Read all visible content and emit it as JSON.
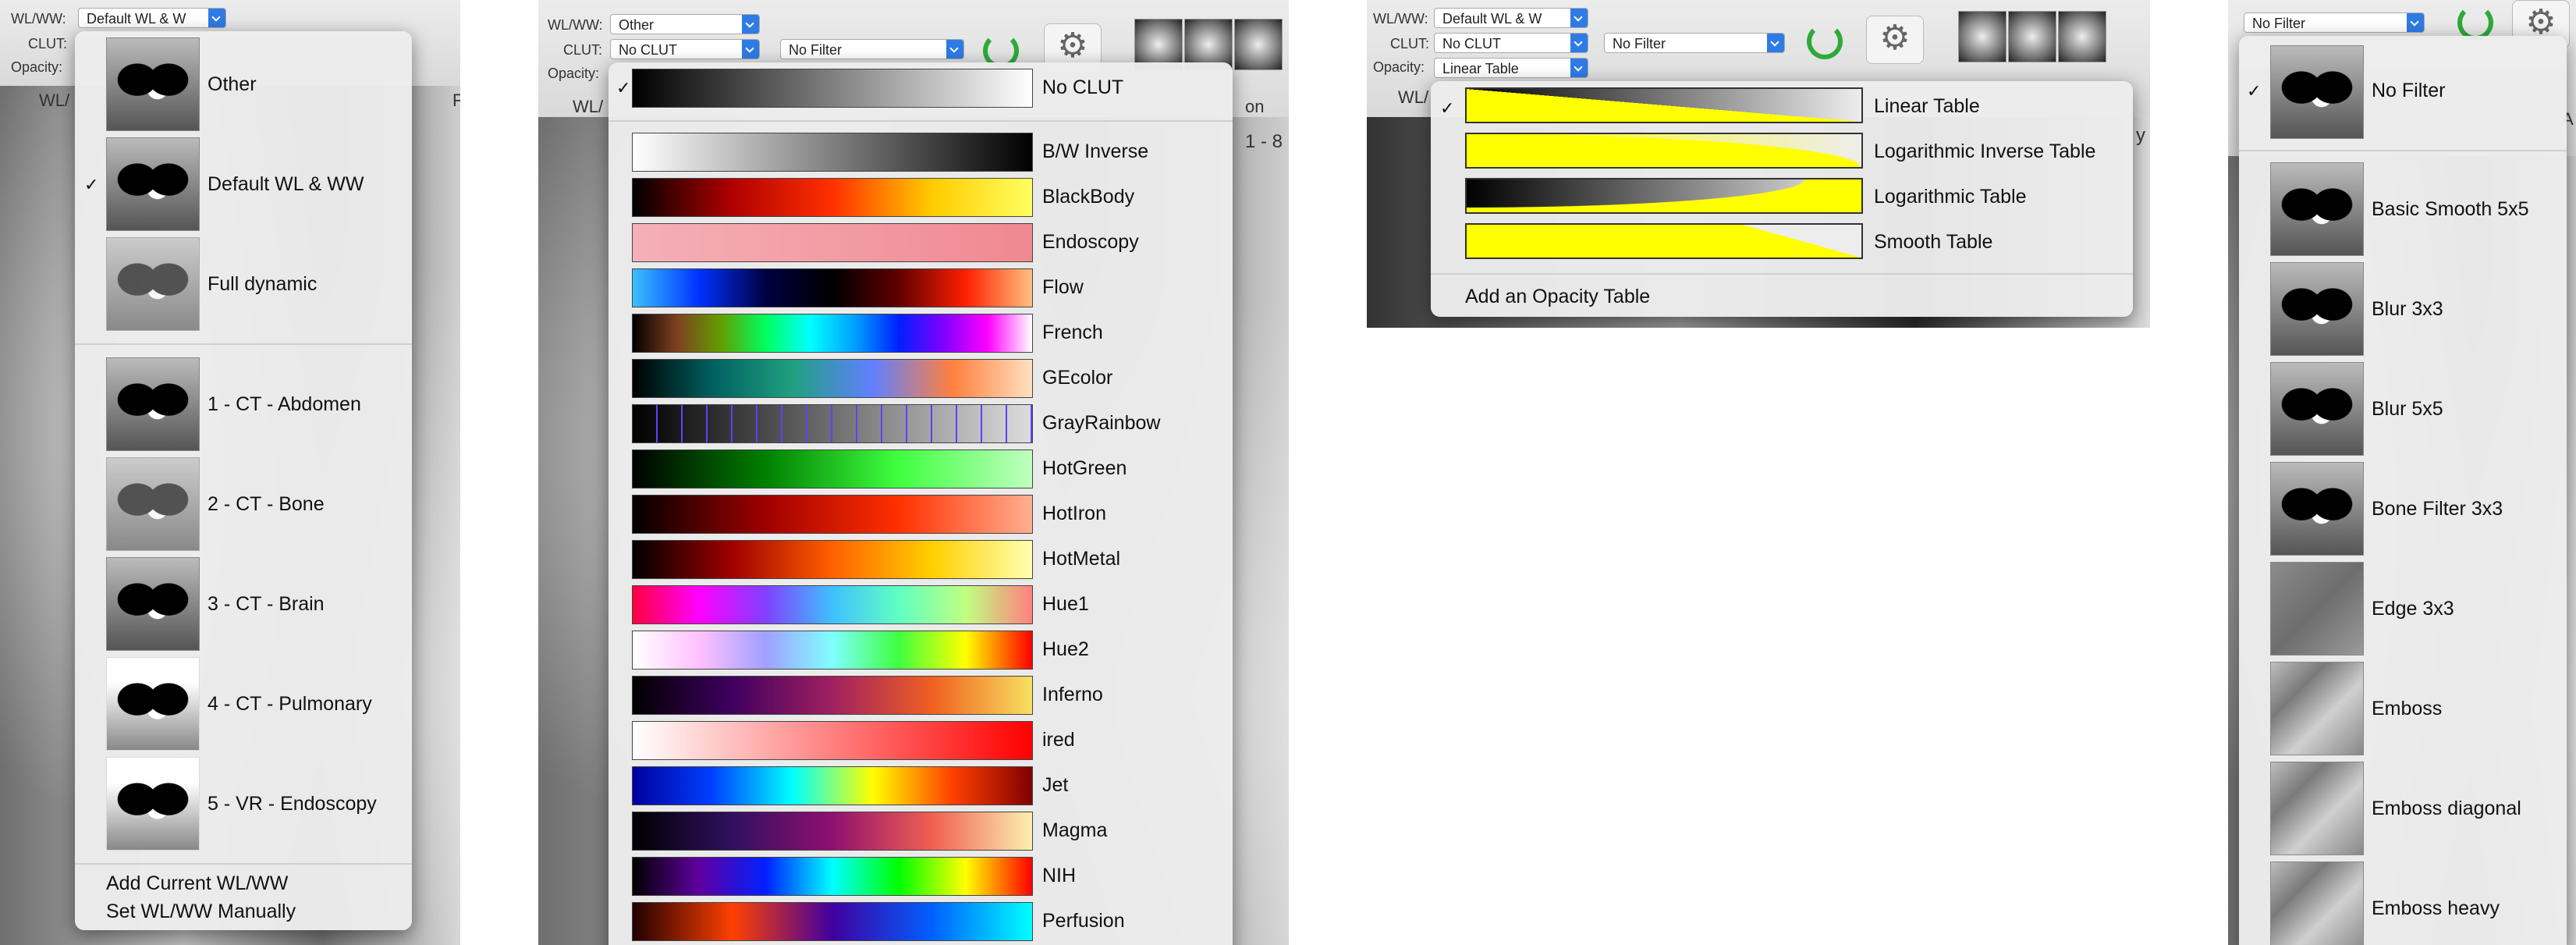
{
  "toolbar": {
    "wlww_label": "WL/WW:",
    "clut_label": "CLUT:",
    "opacity_label": "Opacity:",
    "wlww_value_p1": "Default WL & W",
    "wlww_value_p3": "Default WL & W",
    "wlww_value_p2": "Other",
    "clut_value_p2": "No CLUT",
    "clut_value_p3": "No CLUT",
    "opacity_value_p3": "Linear Table",
    "filter_value_p2": "No Filter",
    "filter_value_p3": "No Filter",
    "filter_value_p4": "No Filter",
    "wl_fragment": "WL/",
    "r_fragment": "F",
    "on_fragment": "on",
    "num_fragment": "1 - 8",
    "y_fragment": "y",
    "a_fragment": "A"
  },
  "wlww_menu": {
    "items": [
      {
        "label": "Other",
        "checked": false
      },
      {
        "label": "Default WL & WW",
        "checked": true
      },
      {
        "label": "Full dynamic",
        "checked": false
      },
      {
        "label": "1 - CT - Abdomen",
        "checked": false
      },
      {
        "label": "2 - CT - Bone",
        "checked": false
      },
      {
        "label": "3 - CT - Brain",
        "checked": false
      },
      {
        "label": "4 - CT - Pulmonary",
        "checked": false
      },
      {
        "label": "5 - VR - Endoscopy",
        "checked": false
      }
    ],
    "actions": [
      "Add Current WL/WW",
      "Set WL/WW Manually"
    ]
  },
  "clut_menu": {
    "items": [
      {
        "label": "No CLUT",
        "checked": true
      },
      {
        "label": "B/W Inverse"
      },
      {
        "label": "BlackBody"
      },
      {
        "label": "Endoscopy"
      },
      {
        "label": "Flow"
      },
      {
        "label": "French"
      },
      {
        "label": "GEcolor"
      },
      {
        "label": "GrayRainbow"
      },
      {
        "label": "HotGreen"
      },
      {
        "label": "HotIron"
      },
      {
        "label": "HotMetal"
      },
      {
        "label": "Hue1"
      },
      {
        "label": "Hue2"
      },
      {
        "label": "Inferno"
      },
      {
        "label": "ired"
      },
      {
        "label": "Jet"
      },
      {
        "label": "Magma"
      },
      {
        "label": "NIH"
      },
      {
        "label": "Perfusion"
      }
    ]
  },
  "opacity_menu": {
    "items": [
      {
        "label": "Linear Table",
        "checked": true
      },
      {
        "label": "Logarithmic Inverse Table"
      },
      {
        "label": "Logarithmic Table"
      },
      {
        "label": "Smooth Table"
      }
    ],
    "action": "Add an Opacity Table"
  },
  "filter_menu": {
    "items": [
      {
        "label": "No Filter",
        "checked": true
      },
      {
        "label": "Basic Smooth 5x5"
      },
      {
        "label": "Blur 3x3"
      },
      {
        "label": "Blur 5x5"
      },
      {
        "label": "Bone Filter 3x3"
      },
      {
        "label": "Edge 3x3"
      },
      {
        "label": "Emboss"
      },
      {
        "label": "Emboss diagonal"
      },
      {
        "label": "Emboss heavy"
      }
    ]
  },
  "colors": {
    "accent": "#2f7be6",
    "refresh_green": "#2daa3a",
    "opacity_yellow": "#ffff00"
  },
  "icons": [
    "checkmark-icon",
    "refresh-icon",
    "gear-icon",
    "dropdown-arrow-icon",
    "head-view-icon"
  ]
}
